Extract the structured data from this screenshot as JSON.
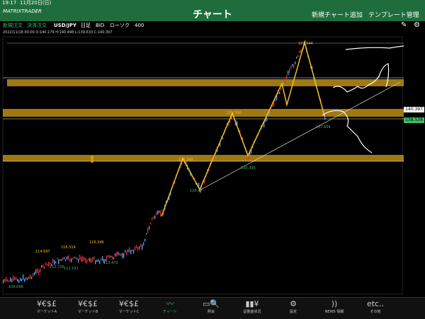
{
  "status_bar": {
    "time": "19:17",
    "date": "11月20日(日)"
  },
  "header": {
    "logo": "MATRIXTRADER",
    "title": "チャート",
    "add_chart": "新規チャート追加",
    "template": "テンプレート管理"
  },
  "toolbar": {
    "new_order": "新規注文",
    "settle_order": "決済注文",
    "pair": "USD/JPY",
    "period": "日足",
    "side": "BID",
    "chart_type": "ローソク",
    "count": "400"
  },
  "ohlc_line": "2022/11/18 00:00   O:140.179  H:140.498  L:139.633  C:140.397",
  "price_labels": {
    "current": "140.397",
    "line": "138.538"
  },
  "chart_annotations": {
    "highs": [
      "151.944",
      "139.390",
      "131.348",
      "116.346",
      "114.697",
      "116.519"
    ],
    "lows": [
      "137.654",
      "130.395",
      "126.37",
      "112.726",
      "112.531",
      "113.472",
      "109.096"
    ]
  },
  "tabs": [
    {
      "icon": "¥€$£",
      "label": "マーケットA"
    },
    {
      "icon": "¥€$£",
      "label": "マーケットB"
    },
    {
      "icon": "¥€$£",
      "label": "マーケットC"
    },
    {
      "icon": "〰",
      "label": "チャート"
    },
    {
      "icon": "▭🔍",
      "label": "照会"
    },
    {
      "icon": "▮▮¥",
      "label": "証拠金状況"
    },
    {
      "icon": "⚙",
      "label": "設定"
    },
    {
      "icon": "))",
      "label": "NEWS\n情報"
    },
    {
      "icon": "etc..",
      "label": "その他"
    }
  ],
  "colors": {
    "header": "#1f6d3c",
    "zone": "#d4a017",
    "up": "#e03030",
    "zigzag": "#f0c020"
  }
}
